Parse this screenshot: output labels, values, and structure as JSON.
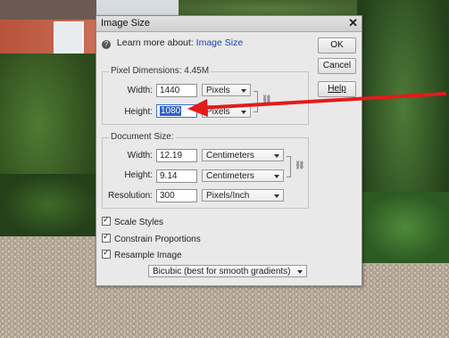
{
  "dialog": {
    "title": "Image Size",
    "close_glyph": "✕",
    "learn_prefix": "Learn more about:",
    "learn_link": "Image Size",
    "buttons": {
      "ok": "OK",
      "cancel": "Cancel",
      "help": "Help"
    }
  },
  "pixel_dimensions": {
    "label": "Pixel Dimensions:",
    "size": "4.45M",
    "width_label": "Width:",
    "width_value": "1440",
    "width_unit": "Pixels",
    "height_label": "Height:",
    "height_value": "1080",
    "height_unit": "Pixels"
  },
  "document_size": {
    "label": "Document Size:",
    "width_label": "Width:",
    "width_value": "12.19",
    "width_unit": "Centimeters",
    "height_label": "Height:",
    "height_value": "9.14",
    "height_unit": "Centimeters",
    "resolution_label": "Resolution:",
    "resolution_value": "300",
    "resolution_unit": "Pixels/Inch"
  },
  "options": {
    "scale_styles": "Scale Styles",
    "constrain_proportions": "Constrain Proportions",
    "resample_image": "Resample Image",
    "resample_method": "Bicubic (best for smooth gradients)"
  },
  "annotation": {
    "arrow_color": "#e31b1b"
  }
}
